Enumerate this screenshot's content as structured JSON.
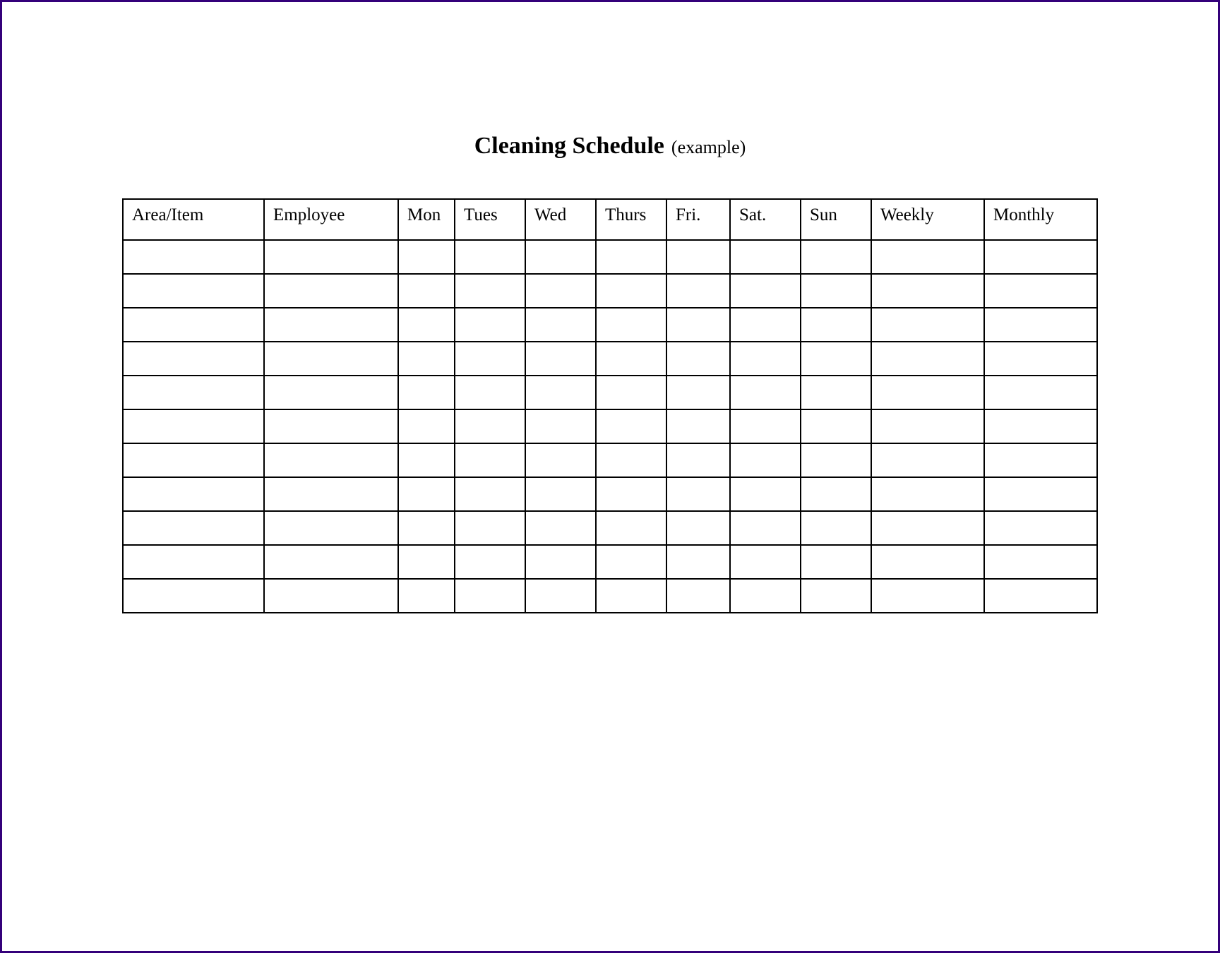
{
  "title": "Cleaning Schedule",
  "subtitle": "(example)",
  "table": {
    "headers": [
      "Area/Item",
      "Employee",
      "Mon",
      "Tues",
      "Wed",
      "Thurs",
      "Fri.",
      "Sat.",
      "Sun",
      "Weekly",
      "Monthly"
    ],
    "rows": [
      [
        "",
        "",
        "",
        "",
        "",
        "",
        "",
        "",
        "",
        "",
        ""
      ],
      [
        "",
        "",
        "",
        "",
        "",
        "",
        "",
        "",
        "",
        "",
        ""
      ],
      [
        "",
        "",
        "",
        "",
        "",
        "",
        "",
        "",
        "",
        "",
        ""
      ],
      [
        "",
        "",
        "",
        "",
        "",
        "",
        "",
        "",
        "",
        "",
        ""
      ],
      [
        "",
        "",
        "",
        "",
        "",
        "",
        "",
        "",
        "",
        "",
        ""
      ],
      [
        "",
        "",
        "",
        "",
        "",
        "",
        "",
        "",
        "",
        "",
        ""
      ],
      [
        "",
        "",
        "",
        "",
        "",
        "",
        "",
        "",
        "",
        "",
        ""
      ],
      [
        "",
        "",
        "",
        "",
        "",
        "",
        "",
        "",
        "",
        "",
        ""
      ],
      [
        "",
        "",
        "",
        "",
        "",
        "",
        "",
        "",
        "",
        "",
        ""
      ],
      [
        "",
        "",
        "",
        "",
        "",
        "",
        "",
        "",
        "",
        "",
        ""
      ],
      [
        "",
        "",
        "",
        "",
        "",
        "",
        "",
        "",
        "",
        "",
        ""
      ]
    ]
  }
}
